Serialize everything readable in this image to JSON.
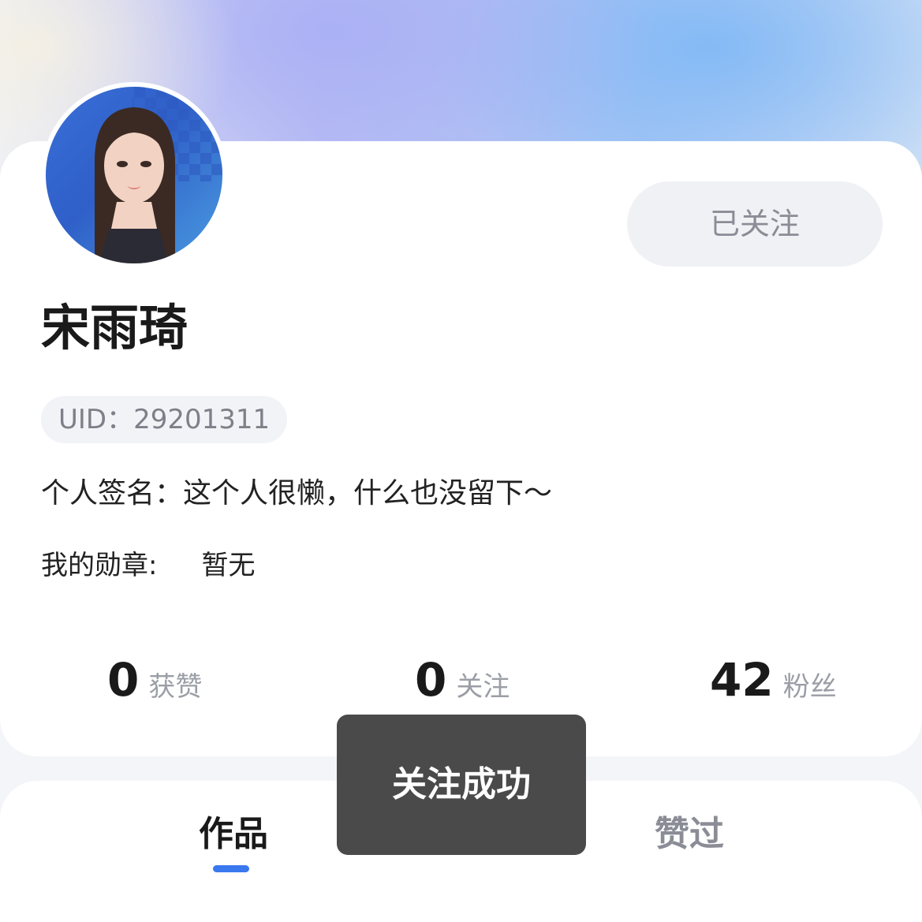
{
  "profile": {
    "avatar_icon": "user-portrait",
    "follow_button_label": "已关注",
    "username": "宋雨琦",
    "uid_text": "UID：29201311",
    "signature_text": "个人签名：这个人很懒，什么也没留下～",
    "medals_label": "我的勋章:",
    "medals_value": "暂无"
  },
  "stats": [
    {
      "count": "0",
      "label": "获赞"
    },
    {
      "count": "0",
      "label": "关注"
    },
    {
      "count": "42",
      "label": "粉丝"
    }
  ],
  "tabs": [
    {
      "label": "作品",
      "active": true
    },
    {
      "label": "赞过",
      "active": false
    }
  ],
  "toast": {
    "message": "关注成功"
  },
  "colors": {
    "accent": "#3a78ee",
    "toast_bg": "#3c3c3c",
    "card_bg": "#ffffff"
  }
}
